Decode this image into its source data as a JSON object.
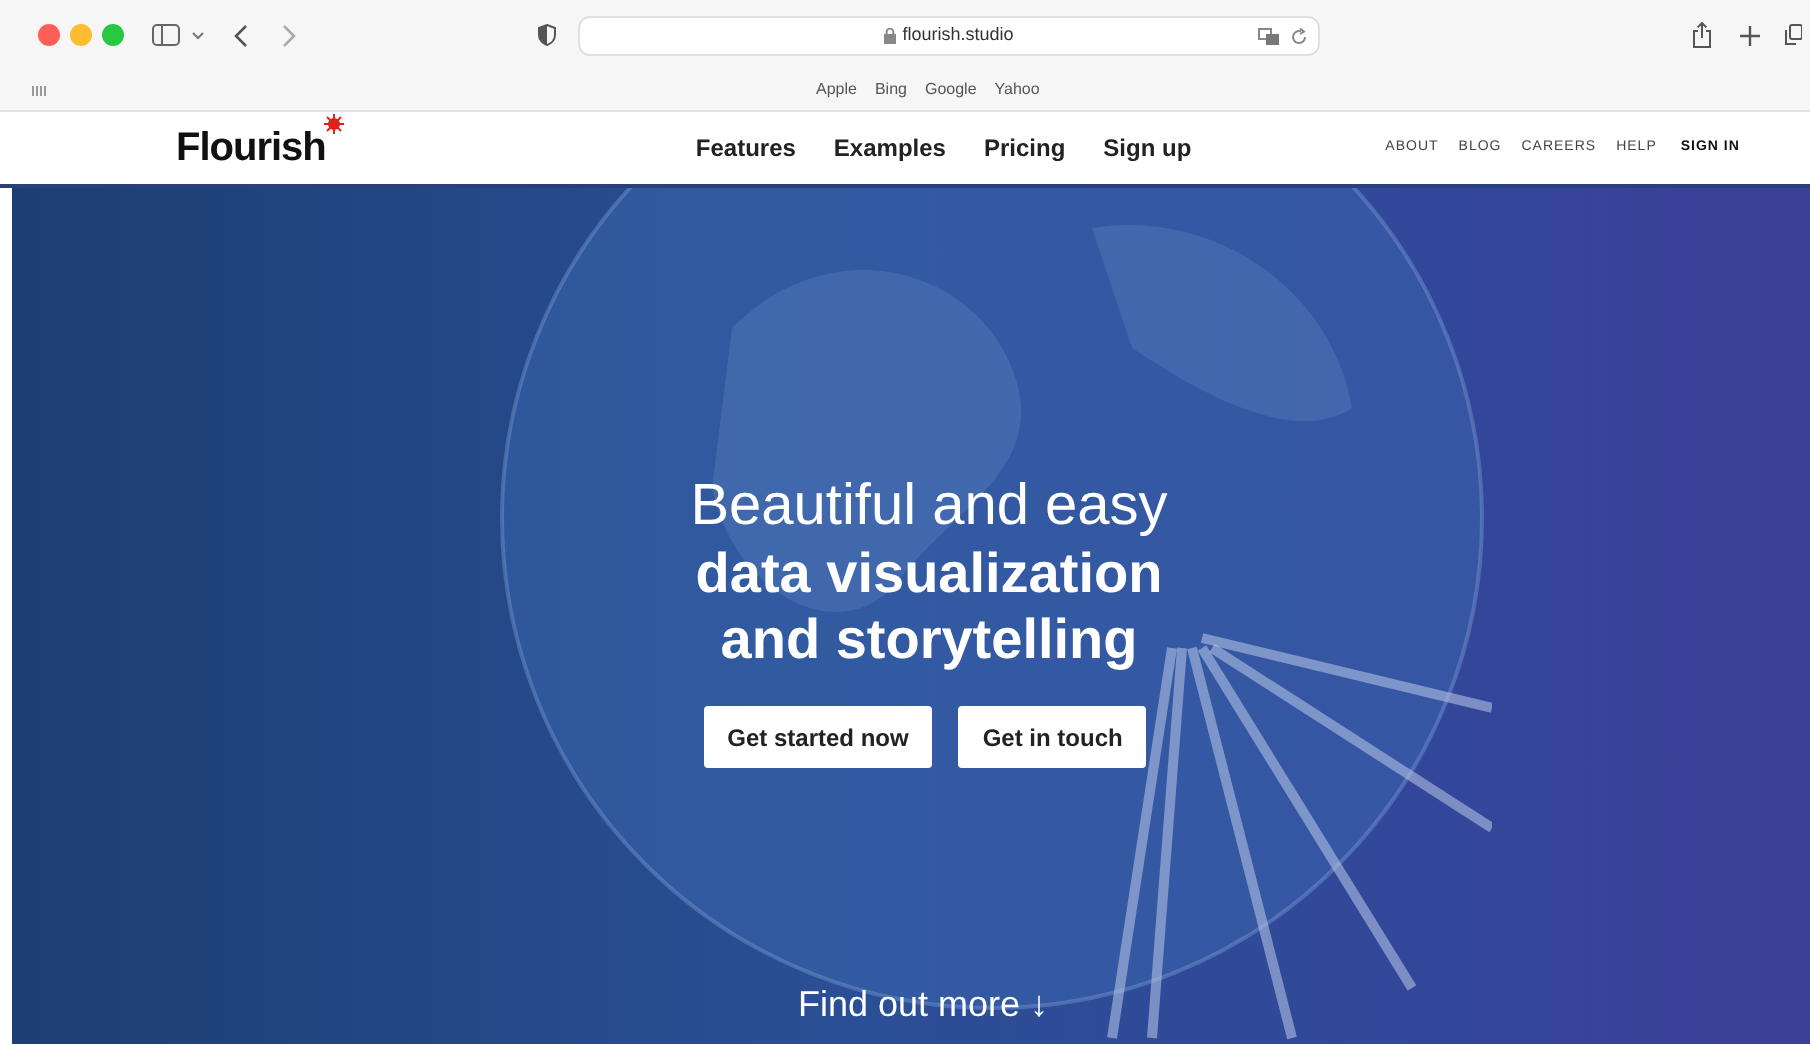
{
  "browser": {
    "address": "flourish.studio",
    "favorites": [
      "Apple",
      "Bing",
      "Google",
      "Yahoo"
    ]
  },
  "site_nav": {
    "logo": "Flourish",
    "main_links": [
      "Features",
      "Examples",
      "Pricing",
      "Sign up"
    ],
    "secondary_links": [
      {
        "label": "ABOUT",
        "emphasized": false
      },
      {
        "label": "BLOG",
        "emphasized": false
      },
      {
        "label": "CAREERS",
        "emphasized": false
      },
      {
        "label": "HELP",
        "emphasized": false
      },
      {
        "label": "SIGN IN",
        "emphasized": true
      }
    ]
  },
  "hero": {
    "headline_light": "Beautiful and easy",
    "headline_bold": [
      "data visualization",
      "and storytelling"
    ],
    "buttons": [
      "Get started now",
      "Get in touch"
    ],
    "find_out_more": "Find out more ↓"
  }
}
